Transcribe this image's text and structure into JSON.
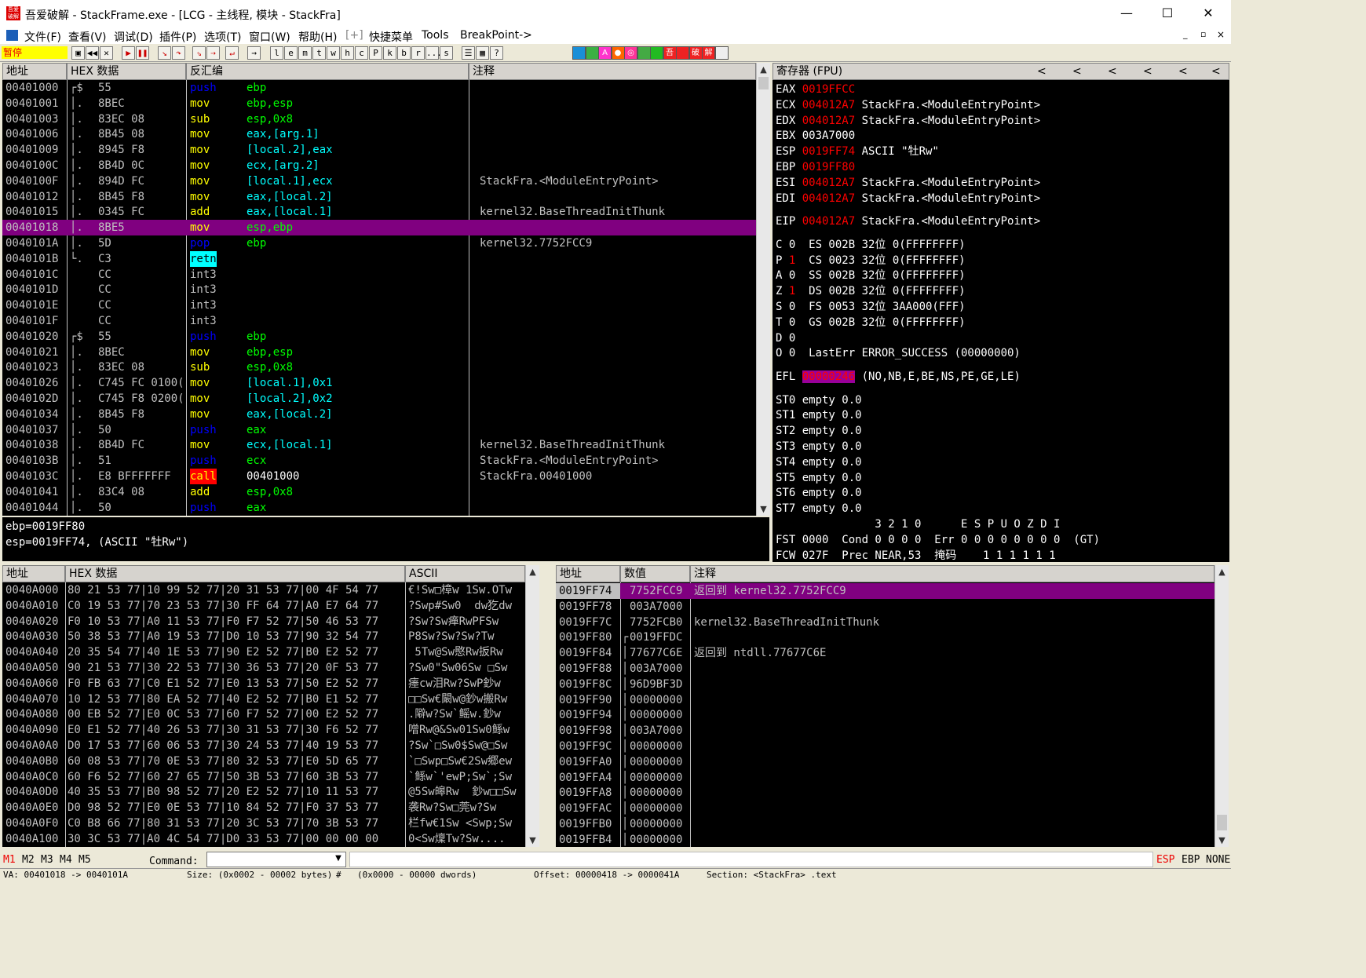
{
  "window": {
    "title": "吾爱破解 - StackFrame.exe - [LCG - 主线程, 模块 - StackFra]",
    "app_icon_text": "吾爱破解",
    "min": "—",
    "max": "☐",
    "close": "✕"
  },
  "menu": {
    "items": [
      "文件(F)",
      "查看(V)",
      "调试(D)",
      "插件(P)",
      "选项(T)",
      "窗口(W)",
      "帮助(H)",
      "[+]",
      "快捷菜单",
      "Tools",
      "BreakPoint->"
    ],
    "right_controls": [
      "_",
      "▫",
      "×"
    ]
  },
  "toolbar": {
    "status": "暂停",
    "letter_buttons": [
      "l",
      "e",
      "m",
      "t",
      "w",
      "h",
      "c",
      "P",
      "k",
      "b",
      "r",
      "...",
      "s"
    ],
    "colored_buttons": [
      {
        "label": "",
        "color": "#1a8fd8"
      },
      {
        "label": "",
        "color": "#3cb043"
      },
      {
        "label": "A",
        "color": "#ff33cc"
      },
      {
        "label": "●",
        "color": "#ff6600"
      },
      {
        "label": "◎",
        "color": "#ff3399"
      },
      {
        "label": "",
        "color": "#44aa44"
      },
      {
        "label": "",
        "color": "#22bb22"
      },
      {
        "label": "吾",
        "color": "#ee2222"
      },
      {
        "label": "",
        "color": "#ee2222"
      },
      {
        "label": "破",
        "color": "#ee2222"
      },
      {
        "label": "解",
        "color": "#ee2222"
      },
      {
        "label": "",
        "color": "#eeeeee"
      }
    ]
  },
  "disasm": {
    "headers": {
      "address": "地址",
      "hex": "HEX 数据",
      "disasm": "反汇编",
      "comment": "注释"
    },
    "rows": [
      {
        "addr": "00401000",
        "mk": "┌$",
        "hex": "55",
        "mn": "push",
        "mc": "#0000ff",
        "op": "ebp",
        "oc": "#00ff00",
        "cm": "",
        "hl": ""
      },
      {
        "addr": "00401001",
        "mk": "│.",
        "hex": "8BEC",
        "mn": "mov",
        "mc": "#ffff00",
        "op": "ebp,esp",
        "oc": "#00ff00",
        "cm": "",
        "hl": ""
      },
      {
        "addr": "00401003",
        "mk": "│.",
        "hex": "83EC 08",
        "mn": "sub",
        "mc": "#ffff00",
        "op": "esp,0x8",
        "oc": "#00ff00",
        "cm": "",
        "hl": ""
      },
      {
        "addr": "00401006",
        "mk": "│.",
        "hex": "8B45 08",
        "mn": "mov",
        "mc": "#ffff00",
        "op": "eax,[arg.1]",
        "oc": "#00ffff",
        "cm": "",
        "hl": ""
      },
      {
        "addr": "00401009",
        "mk": "│.",
        "hex": "8945 F8",
        "mn": "mov",
        "mc": "#ffff00",
        "op": "[local.2],eax",
        "oc": "#00ffff",
        "cm": "",
        "hl": ""
      },
      {
        "addr": "0040100C",
        "mk": "│.",
        "hex": "8B4D 0C",
        "mn": "mov",
        "mc": "#ffff00",
        "op": "ecx,[arg.2]",
        "oc": "#00ffff",
        "cm": "",
        "hl": ""
      },
      {
        "addr": "0040100F",
        "mk": "│.",
        "hex": "894D FC",
        "mn": "mov",
        "mc": "#ffff00",
        "op": "[local.1],ecx",
        "oc": "#00ffff",
        "cm": "StackFra.<ModuleEntryPoint>",
        "hl": ""
      },
      {
        "addr": "00401012",
        "mk": "│.",
        "hex": "8B45 F8",
        "mn": "mov",
        "mc": "#ffff00",
        "op": "eax,[local.2]",
        "oc": "#00ffff",
        "cm": "",
        "hl": ""
      },
      {
        "addr": "00401015",
        "mk": "│.",
        "hex": "0345 FC",
        "mn": "add",
        "mc": "#ffff00",
        "op": "eax,[local.1]",
        "oc": "#00ffff",
        "cm": "kernel32.BaseThreadInitThunk",
        "hl": ""
      },
      {
        "addr": "00401018",
        "mk": "│.",
        "hex": "8BE5",
        "mn": "mov",
        "mc": "#ffff00",
        "op": "esp,ebp",
        "oc": "#00ff00",
        "cm": "",
        "hl": "row"
      },
      {
        "addr": "0040101A",
        "mk": "│.",
        "hex": "5D",
        "mn": "pop",
        "mc": "#0000ff",
        "op": "ebp",
        "oc": "#00ff00",
        "cm": "kernel32.7752FCC9",
        "hl": ""
      },
      {
        "addr": "0040101B",
        "mk": "└.",
        "hex": "C3",
        "mn": "retn",
        "mc": "#000000",
        "op": "",
        "oc": "#00ff00",
        "cm": "",
        "hl": "retn"
      },
      {
        "addr": "0040101C",
        "mk": "",
        "hex": "CC",
        "mn": "int3",
        "mc": "#c0c0c0",
        "op": "",
        "oc": "#00ff00",
        "cm": "",
        "hl": ""
      },
      {
        "addr": "0040101D",
        "mk": "",
        "hex": "CC",
        "mn": "int3",
        "mc": "#c0c0c0",
        "op": "",
        "oc": "#00ff00",
        "cm": "",
        "hl": ""
      },
      {
        "addr": "0040101E",
        "mk": "",
        "hex": "CC",
        "mn": "int3",
        "mc": "#c0c0c0",
        "op": "",
        "oc": "#00ff00",
        "cm": "",
        "hl": ""
      },
      {
        "addr": "0040101F",
        "mk": "",
        "hex": "CC",
        "mn": "int3",
        "mc": "#c0c0c0",
        "op": "",
        "oc": "#00ff00",
        "cm": "",
        "hl": ""
      },
      {
        "addr": "00401020",
        "mk": "┌$",
        "hex": "55",
        "mn": "push",
        "mc": "#0000ff",
        "op": "ebp",
        "oc": "#00ff00",
        "cm": "",
        "hl": ""
      },
      {
        "addr": "00401021",
        "mk": "│.",
        "hex": "8BEC",
        "mn": "mov",
        "mc": "#ffff00",
        "op": "ebp,esp",
        "oc": "#00ff00",
        "cm": "",
        "hl": ""
      },
      {
        "addr": "00401023",
        "mk": "│.",
        "hex": "83EC 08",
        "mn": "sub",
        "mc": "#ffff00",
        "op": "esp,0x8",
        "oc": "#00ff00",
        "cm": "",
        "hl": ""
      },
      {
        "addr": "00401026",
        "mk": "│.",
        "hex": "C745 FC 0100(",
        "mn": "mov",
        "mc": "#ffff00",
        "op": "[local.1],0x1",
        "oc": "#00ffff",
        "cm": "",
        "hl": ""
      },
      {
        "addr": "0040102D",
        "mk": "│.",
        "hex": "C745 F8 0200(",
        "mn": "mov",
        "mc": "#ffff00",
        "op": "[local.2],0x2",
        "oc": "#00ffff",
        "cm": "",
        "hl": ""
      },
      {
        "addr": "00401034",
        "mk": "│.",
        "hex": "8B45 F8",
        "mn": "mov",
        "mc": "#ffff00",
        "op": "eax,[local.2]",
        "oc": "#00ffff",
        "cm": "",
        "hl": ""
      },
      {
        "addr": "00401037",
        "mk": "│.",
        "hex": "50",
        "mn": "push",
        "mc": "#0000ff",
        "op": "eax",
        "oc": "#00ff00",
        "cm": "",
        "hl": ""
      },
      {
        "addr": "00401038",
        "mk": "│.",
        "hex": "8B4D FC",
        "mn": "mov",
        "mc": "#ffff00",
        "op": "ecx,[local.1]",
        "oc": "#00ffff",
        "cm": "kernel32.BaseThreadInitThunk",
        "hl": ""
      },
      {
        "addr": "0040103B",
        "mk": "│.",
        "hex": "51",
        "mn": "push",
        "mc": "#0000ff",
        "op": "ecx",
        "oc": "#00ff00",
        "cm": "StackFra.<ModuleEntryPoint>",
        "hl": ""
      },
      {
        "addr": "0040103C",
        "mk": "│.",
        "hex": "E8 BFFFFFFF",
        "mn": "call",
        "mc": "#000000",
        "op": "00401000",
        "oc": "#ffffff",
        "cm": "StackFra.00401000",
        "hl": "call"
      },
      {
        "addr": "00401041",
        "mk": "│.",
        "hex": "83C4 08",
        "mn": "add",
        "mc": "#ffff00",
        "op": "esp,0x8",
        "oc": "#00ff00",
        "cm": "",
        "hl": ""
      },
      {
        "addr": "00401044",
        "mk": "│.",
        "hex": "50",
        "mn": "push",
        "mc": "#0000ff",
        "op": "eax",
        "oc": "#00ff00",
        "cm": "",
        "hl": ""
      }
    ]
  },
  "info": {
    "lines": [
      "ebp=0019FF80",
      "esp=0019FF74, (ASCII \"牡Rw\")"
    ]
  },
  "registers": {
    "header": "寄存器 (FPU)",
    "header_arrows": [
      "<",
      "<",
      "<",
      "<",
      "<",
      "<"
    ],
    "lines": [
      {
        "parts": [
          {
            "t": "EAX ",
            "c": "#ffffff"
          },
          {
            "t": "0019FFCC",
            "c": "#ff0000"
          }
        ]
      },
      {
        "parts": [
          {
            "t": "ECX ",
            "c": "#ffffff"
          },
          {
            "t": "004012A7",
            "c": "#ff0000"
          },
          {
            "t": " StackFra.<ModuleEntryPoint>",
            "c": "#ffffff"
          }
        ]
      },
      {
        "parts": [
          {
            "t": "EDX ",
            "c": "#ffffff"
          },
          {
            "t": "004012A7",
            "c": "#ff0000"
          },
          {
            "t": " StackFra.<ModuleEntryPoint>",
            "c": "#ffffff"
          }
        ]
      },
      {
        "parts": [
          {
            "t": "EBX 003A7000",
            "c": "#ffffff"
          }
        ]
      },
      {
        "parts": [
          {
            "t": "ESP ",
            "c": "#ffffff"
          },
          {
            "t": "0019FF74",
            "c": "#ff0000"
          },
          {
            "t": " ASCII \"牡Rw\"",
            "c": "#ffffff"
          }
        ]
      },
      {
        "parts": [
          {
            "t": "EBP ",
            "c": "#ffffff"
          },
          {
            "t": "0019FF80",
            "c": "#ff0000"
          }
        ]
      },
      {
        "parts": [
          {
            "t": "ESI ",
            "c": "#ffffff"
          },
          {
            "t": "004012A7",
            "c": "#ff0000"
          },
          {
            "t": " StackFra.<ModuleEntryPoint>",
            "c": "#ffffff"
          }
        ]
      },
      {
        "parts": [
          {
            "t": "EDI ",
            "c": "#ffffff"
          },
          {
            "t": "004012A7",
            "c": "#ff0000"
          },
          {
            "t": " StackFra.<ModuleEntryPoint>",
            "c": "#ffffff"
          }
        ]
      },
      {
        "gap": true
      },
      {
        "parts": [
          {
            "t": "EIP ",
            "c": "#ffffff"
          },
          {
            "t": "004012A7",
            "c": "#ff0000"
          },
          {
            "t": " StackFra.<ModuleEntryPoint>",
            "c": "#ffffff"
          }
        ]
      },
      {
        "gap": true
      },
      {
        "parts": [
          {
            "t": "C 0  ES 002B 32位 0(FFFFFFFF)",
            "c": "#ffffff"
          }
        ]
      },
      {
        "parts": [
          {
            "t": "P ",
            "c": "#ffffff"
          },
          {
            "t": "1",
            "c": "#ff0000"
          },
          {
            "t": "  CS 0023 32位 0(FFFFFFFF)",
            "c": "#ffffff"
          }
        ]
      },
      {
        "parts": [
          {
            "t": "A 0  SS 002B 32位 0(FFFFFFFF)",
            "c": "#ffffff"
          }
        ]
      },
      {
        "parts": [
          {
            "t": "Z ",
            "c": "#ffffff"
          },
          {
            "t": "1",
            "c": "#ff0000"
          },
          {
            "t": "  DS 002B 32位 0(FFFFFFFF)",
            "c": "#ffffff"
          }
        ]
      },
      {
        "parts": [
          {
            "t": "S 0  FS 0053 32位 3AA000(FFF)",
            "c": "#ffffff"
          }
        ]
      },
      {
        "parts": [
          {
            "t": "T 0  GS 002B 32位 0(FFFFFFFF)",
            "c": "#ffffff"
          }
        ]
      },
      {
        "parts": [
          {
            "t": "D 0",
            "c": "#ffffff"
          }
        ]
      },
      {
        "parts": [
          {
            "t": "O 0  LastErr ERROR_SUCCESS (00000000)",
            "c": "#ffffff"
          }
        ]
      },
      {
        "gap": true
      },
      {
        "parts": [
          {
            "t": "EFL ",
            "c": "#ffffff"
          },
          {
            "t": "00000246",
            "c": "#ff0000",
            "bg": "#990099"
          },
          {
            "t": " (NO,NB,E,BE,NS,PE,GE,LE)",
            "c": "#ffffff"
          }
        ]
      },
      {
        "gap": true
      },
      {
        "parts": [
          {
            "t": "ST0 empty 0.0",
            "c": "#ffffff"
          }
        ]
      },
      {
        "parts": [
          {
            "t": "ST1 empty 0.0",
            "c": "#ffffff"
          }
        ]
      },
      {
        "parts": [
          {
            "t": "ST2 empty 0.0",
            "c": "#ffffff"
          }
        ]
      },
      {
        "parts": [
          {
            "t": "ST3 empty 0.0",
            "c": "#ffffff"
          }
        ]
      },
      {
        "parts": [
          {
            "t": "ST4 empty 0.0",
            "c": "#ffffff"
          }
        ]
      },
      {
        "parts": [
          {
            "t": "ST5 empty 0.0",
            "c": "#ffffff"
          }
        ]
      },
      {
        "parts": [
          {
            "t": "ST6 empty 0.0",
            "c": "#ffffff"
          }
        ]
      },
      {
        "parts": [
          {
            "t": "ST7 empty 0.0",
            "c": "#ffffff"
          }
        ]
      },
      {
        "parts": [
          {
            "t": "               3 2 1 0      E S P U O Z D I",
            "c": "#ffffff"
          }
        ]
      },
      {
        "parts": [
          {
            "t": "FST 0000  Cond 0 0 0 0  Err 0 0 0 0 0 0 0 0  (GT)",
            "c": "#ffffff"
          }
        ]
      },
      {
        "parts": [
          {
            "t": "FCW 027F  Prec NEAR,53  掩码    1 1 1 1 1 1",
            "c": "#ffffff"
          }
        ]
      }
    ]
  },
  "dump": {
    "headers": {
      "address": "地址",
      "hex": "HEX 数据",
      "ascii": "ASCII"
    },
    "rows": [
      {
        "addr": "0040A000",
        "hex": "80 21 53 77|10 99 52 77|20 31 53 77|00 4F 54 77",
        "ascii": "€!Sw□樟w 1Sw.OTw"
      },
      {
        "addr": "0040A010",
        "hex": "C0 19 53 77|70 23 53 77|30 FF 64 77|A0 E7 64 77",
        "ascii": "?Swp#Sw0  dw犵dw"
      },
      {
        "addr": "0040A020",
        "hex": "F0 10 53 77|A0 11 53 77|F0 F7 52 77|50 46 53 77",
        "ascii": "?Sw?Sw瘅RwPFSw"
      },
      {
        "addr": "0040A030",
        "hex": "50 38 53 77|A0 19 53 77|D0 10 53 77|90 32 54 77",
        "ascii": "P8Sw?Sw?Sw?Tw"
      },
      {
        "addr": "0040A040",
        "hex": "20 35 54 77|40 1E 53 77|90 E2 52 77|B0 E2 52 77",
        "ascii": " 5Tw@Sw愍Rw扳Rw"
      },
      {
        "addr": "0040A050",
        "hex": "90 21 53 77|30 22 53 77|30 36 53 77|20 0F 53 77",
        "ascii": "?Sw0\"Sw06Sw □Sw"
      },
      {
        "addr": "0040A060",
        "hex": "F0 FB 63 77|C0 E1 52 77|E0 13 53 77|50 E2 52 77",
        "ascii": "瘗cw泪Rw?SwP鈔w"
      },
      {
        "addr": "0040A070",
        "hex": "10 12 53 77|80 EA 52 77|40 E2 52 77|B0 E1 52 77",
        "ascii": "□□Sw€闞w@鈔w搬Rw"
      },
      {
        "addr": "0040A080",
        "hex": "00 EB 52 77|E0 0C 53 77|60 F7 52 77|00 E2 52 77",
        "ascii": ".隦w?Sw`鳐w.鈔w"
      },
      {
        "addr": "0040A090",
        "hex": "E0 E1 52 77|40 26 53 77|30 31 53 77|30 F6 52 77",
        "ascii": "噌Rw@&Sw01Sw0鲧w"
      },
      {
        "addr": "0040A0A0",
        "hex": "D0 17 53 77|60 06 53 77|30 24 53 77|40 19 53 77",
        "ascii": "?Sw`□Sw0$Sw@□Sw"
      },
      {
        "addr": "0040A0B0",
        "hex": "60 08 53 77|70 0E 53 77|80 32 53 77|E0 5D 65 77",
        "ascii": "`□Swp□Sw€2Sw郷ew"
      },
      {
        "addr": "0040A0C0",
        "hex": "60 F6 52 77|60 27 65 77|50 3B 53 77|60 3B 53 77",
        "ascii": "`鲧w`'ewP;Sw`;Sw"
      },
      {
        "addr": "0040A0D0",
        "hex": "40 35 53 77|B0 98 52 77|20 E2 52 77|10 11 53 77",
        "ascii": "@5Sw皞Rw  鈔w□□Sw"
      },
      {
        "addr": "0040A0E0",
        "hex": "D0 98 52 77|E0 0E 53 77|10 84 52 77|F0 37 53 77",
        "ascii": "袭Rw?Sw□莞w?Sw"
      },
      {
        "addr": "0040A0F0",
        "hex": "C0 B8 66 77|80 31 53 77|20 3C 53 77|70 3B 53 77",
        "ascii": "栏fw€1Sw <Swp;Sw"
      },
      {
        "addr": "0040A100",
        "hex": "30 3C 53 77|A0 4C 54 77|D0 33 53 77|00 00 00 00",
        "ascii": "0<Sw燣Tw?Sw...."
      }
    ]
  },
  "stack": {
    "headers": {
      "address": "地址",
      "value": "数值",
      "comment": "注释"
    },
    "rows": [
      {
        "addr": "0019FF74",
        "val": "7752FCC9",
        "mk": "",
        "cm": "返回到 kernel32.7752FCC9",
        "hl": true
      },
      {
        "addr": "0019FF78",
        "val": "003A7000",
        "mk": "",
        "cm": "",
        "hl": false
      },
      {
        "addr": "0019FF7C",
        "val": "7752FCB0",
        "mk": "",
        "cm": "kernel32.BaseThreadInitThunk",
        "hl": false
      },
      {
        "addr": "0019FF80",
        "val": "0019FFDC",
        "mk": "┌",
        "cm": "",
        "hl": false
      },
      {
        "addr": "0019FF84",
        "val": "77677C6E",
        "mk": "│",
        "cm": "返回到 ntdll.77677C6E",
        "hl": false
      },
      {
        "addr": "0019FF88",
        "val": "003A7000",
        "mk": "│",
        "cm": "",
        "hl": false
      },
      {
        "addr": "0019FF8C",
        "val": "96D9BF3D",
        "mk": "│",
        "cm": "",
        "hl": false
      },
      {
        "addr": "0019FF90",
        "val": "00000000",
        "mk": "│",
        "cm": "",
        "hl": false
      },
      {
        "addr": "0019FF94",
        "val": "00000000",
        "mk": "│",
        "cm": "",
        "hl": false
      },
      {
        "addr": "0019FF98",
        "val": "003A7000",
        "mk": "│",
        "cm": "",
        "hl": false
      },
      {
        "addr": "0019FF9C",
        "val": "00000000",
        "mk": "│",
        "cm": "",
        "hl": false
      },
      {
        "addr": "0019FFA0",
        "val": "00000000",
        "mk": "│",
        "cm": "",
        "hl": false
      },
      {
        "addr": "0019FFA4",
        "val": "00000000",
        "mk": "│",
        "cm": "",
        "hl": false
      },
      {
        "addr": "0019FFA8",
        "val": "00000000",
        "mk": "│",
        "cm": "",
        "hl": false
      },
      {
        "addr": "0019FFAC",
        "val": "00000000",
        "mk": "│",
        "cm": "",
        "hl": false
      },
      {
        "addr": "0019FFB0",
        "val": "00000000",
        "mk": "│",
        "cm": "",
        "hl": false
      },
      {
        "addr": "0019FFB4",
        "val": "00000000",
        "mk": "│",
        "cm": "",
        "hl": false
      }
    ]
  },
  "bottom": {
    "tabs": [
      "M1",
      "M2",
      "M3",
      "M4",
      "M5"
    ],
    "command_label": "Command:",
    "command_value": "",
    "right_labels": [
      "ESP",
      "EBP",
      "NONE"
    ]
  },
  "status": {
    "va": "VA: 00401018 -> 0040101A",
    "size": "Size: (0x0002 - 00002 bytes)",
    "hash": "#",
    "dwords": "(0x0000 - 00000 dwords)",
    "offset": "Offset: 00000418 -> 0000041A",
    "section": "Section: <StackFra> .text"
  },
  "colors": {
    "purple": "#800080",
    "addr": "#c0c0c0",
    "hex": "#c0c0c0",
    "cyan": "#00ffff"
  }
}
